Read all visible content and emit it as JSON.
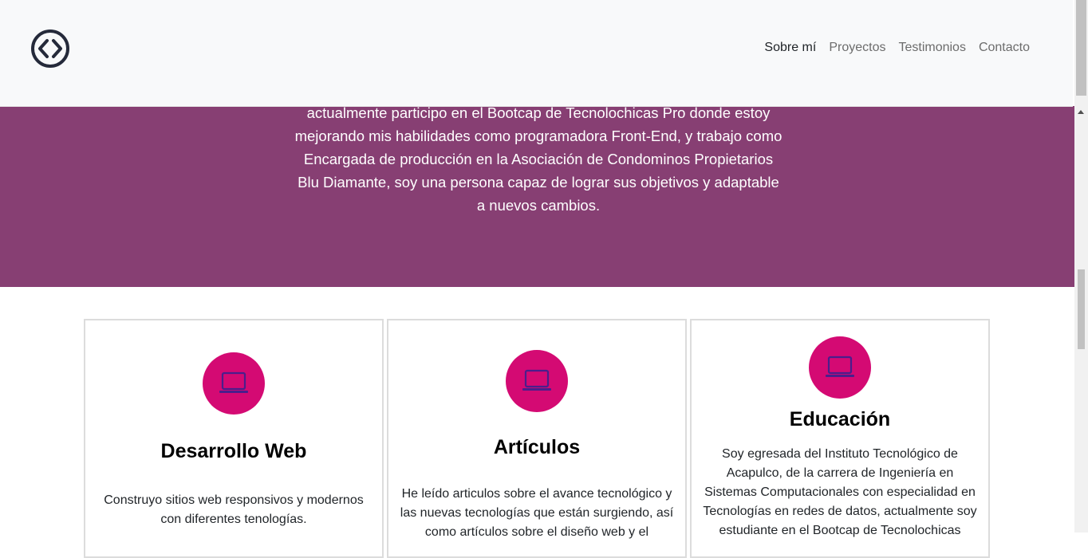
{
  "nav": {
    "links": [
      "Sobre mí",
      "Proyectos",
      "Testimonios",
      "Contacto"
    ]
  },
  "about": {
    "text": "actualmente participo en el Bootcap de Tecnolochicas Pro donde estoy mejorando mis habilidades como programadora Front-End, y trabajo como Encargada de producción en la Asociación de Condominos Propietarios Blu Diamante, soy una persona capaz de lograr sus objetivos y adaptable a nuevos cambios."
  },
  "cards": [
    {
      "icon": "laptop-icon",
      "title": "Desarrollo Web",
      "text": "Construyo sitios web responsivos y modernos con diferentes tenologías."
    },
    {
      "icon": "laptop-icon",
      "title": "Artículos",
      "text": "He leído articulos sobre el avance tecnológico y las nuevas tecnologías que están surgiendo, así como artículos sobre el diseño web y el"
    },
    {
      "icon": "laptop-icon",
      "title": "Educación",
      "text": "Soy egresada del Instituto Tecnológico de Acapulco, de la carrera de Ingeniería en Sistemas Computacionales con especialidad en Tecnologías en redes de datos, actualmente soy estudiante en el Bootcap de Tecnolochicas"
    }
  ],
  "colors": {
    "purple": "#873f73",
    "pink": "#d40a73",
    "icon": "#4a1e8c"
  }
}
